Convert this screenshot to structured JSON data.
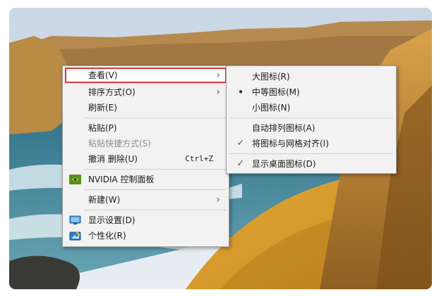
{
  "context_menu": {
    "items": [
      {
        "label": "查看(V)",
        "has_submenu": true,
        "highlighted": true
      },
      {
        "label": "排序方式(O)",
        "has_submenu": true
      },
      {
        "label": "刷新(E)"
      },
      {
        "label": "粘贴(P)"
      },
      {
        "label": "粘贴快捷方式(S)",
        "disabled": true
      },
      {
        "label": "撤消 删除(U)",
        "shortcut": "Ctrl+Z"
      },
      {
        "label": "NVIDIA 控制面板",
        "icon": "nvidia-icon"
      },
      {
        "label": "新建(W)",
        "has_submenu": true
      },
      {
        "label": "显示设置(D)",
        "icon": "display-settings-icon"
      },
      {
        "label": "个性化(R)",
        "icon": "personalize-icon"
      }
    ],
    "submenu_arrow": "›",
    "highlight_color": "#d93a3a"
  },
  "view_submenu": {
    "items": [
      {
        "label": "大图标(R)"
      },
      {
        "label": "中等图标(M)",
        "selected": true,
        "mark": "•"
      },
      {
        "label": "小图标(N)"
      },
      {
        "label": "自动排列图标(A)"
      },
      {
        "label": "将图标与网格对齐(I)",
        "checked": true,
        "mark": "✓"
      },
      {
        "label": "显示桌面图标(D)",
        "checked": true,
        "mark": "✓"
      }
    ]
  }
}
